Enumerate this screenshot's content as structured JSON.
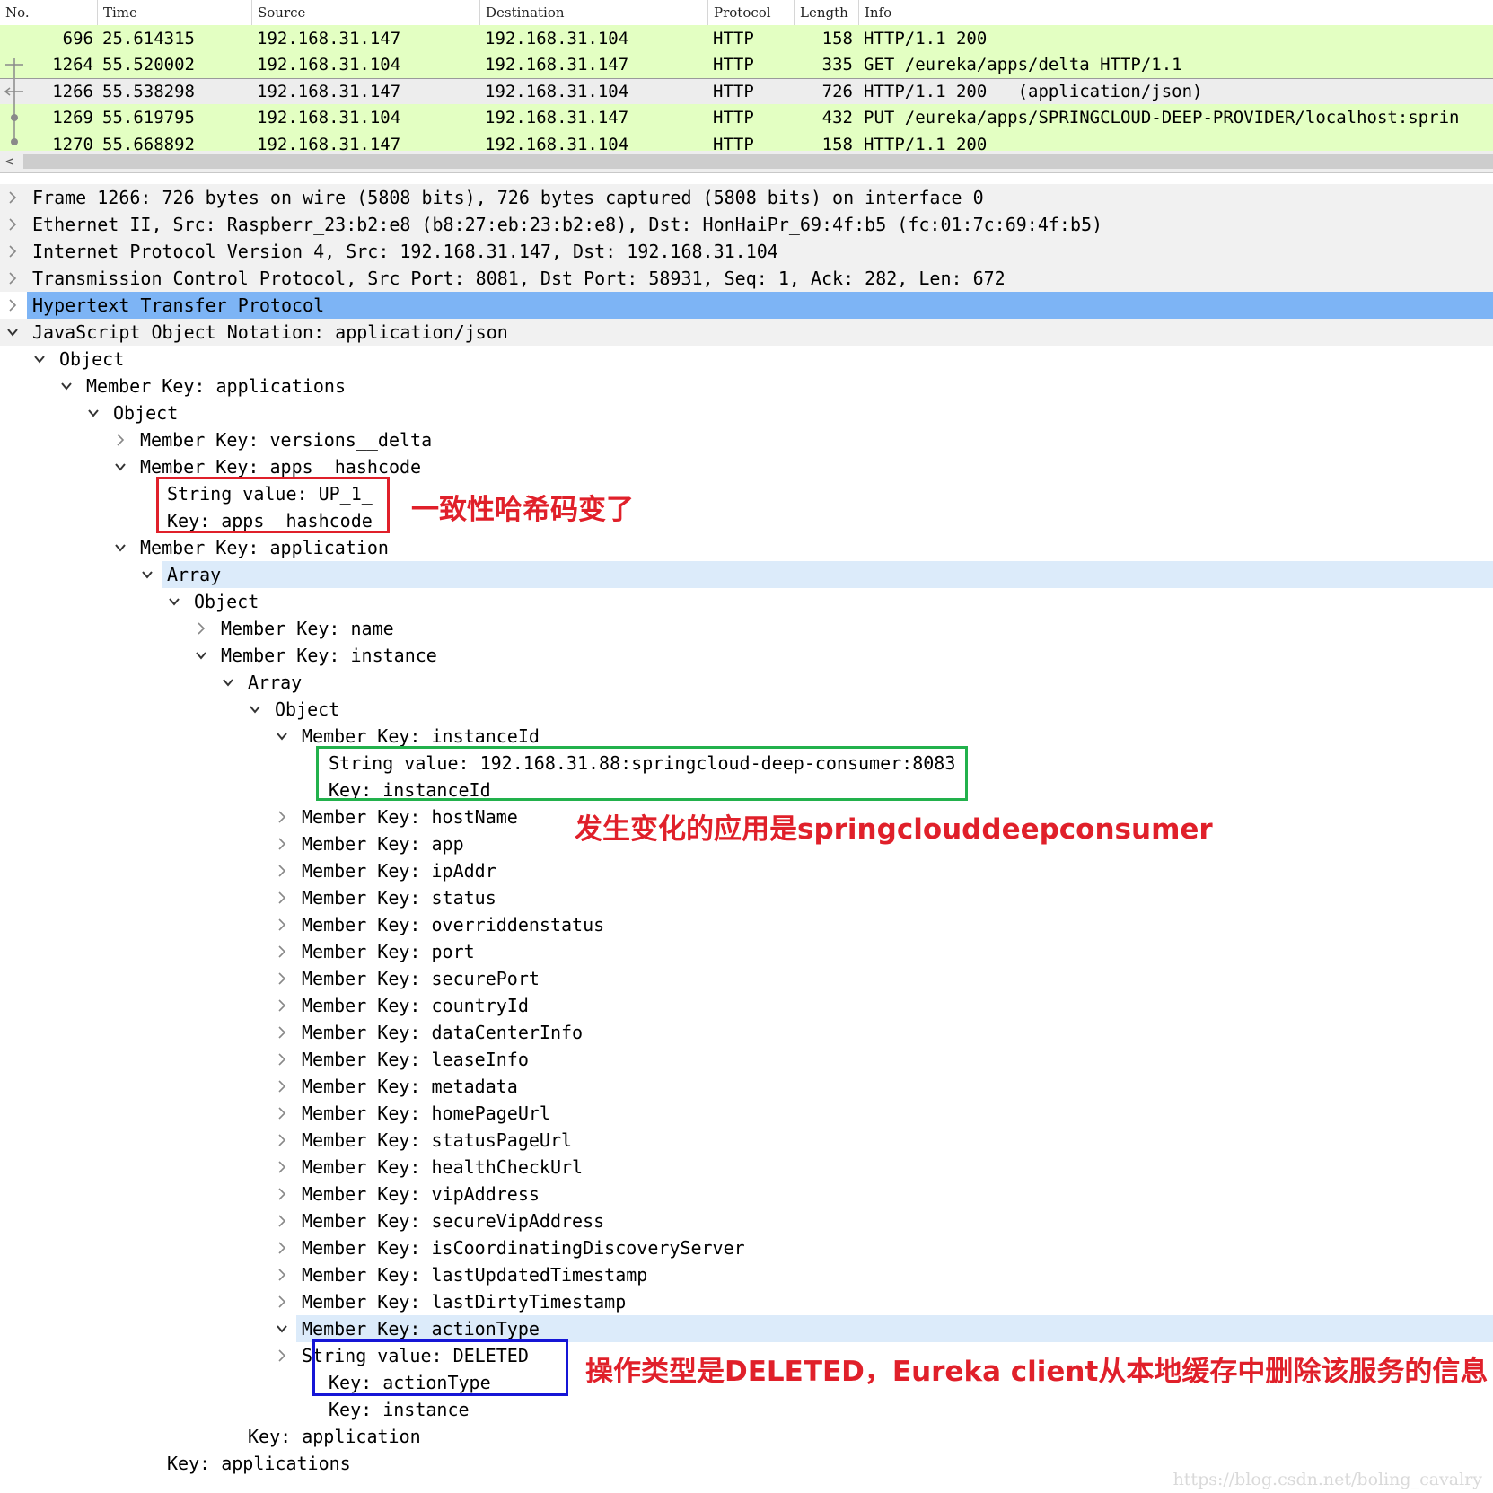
{
  "packet_list": {
    "columns": [
      "No.",
      "Time",
      "Source",
      "Destination",
      "Protocol",
      "Length",
      "Info"
    ],
    "rows": [
      {
        "no": "696",
        "time": "25.614315",
        "source": "192.168.31.147",
        "destination": "192.168.31.104",
        "protocol": "HTTP",
        "length": "158",
        "info": "HTTP/1.1 200"
      },
      {
        "no": "1264",
        "time": "55.520002",
        "source": "192.168.31.104",
        "destination": "192.168.31.147",
        "protocol": "HTTP",
        "length": "335",
        "info": "GET /eureka/apps/delta HTTP/1.1"
      },
      {
        "no": "1266",
        "time": "55.538298",
        "source": "192.168.31.147",
        "destination": "192.168.31.104",
        "protocol": "HTTP",
        "length": "726",
        "info": "HTTP/1.1 200   (application/json)"
      },
      {
        "no": "1269",
        "time": "55.619795",
        "source": "192.168.31.104",
        "destination": "192.168.31.147",
        "protocol": "HTTP",
        "length": "432",
        "info": "PUT /eureka/apps/SPRINGCLOUD-DEEP-PROVIDER/localhost:sprin"
      },
      {
        "no": "1270",
        "time": "55.668892",
        "source": "192.168.31.147",
        "destination": "192.168.31.104",
        "protocol": "HTTP",
        "length": "158",
        "info": "HTTP/1.1 200"
      }
    ],
    "scroll_left_arrow": "<"
  },
  "details": [
    {
      "text": "Frame 1266: 726 bytes on wire (5808 bits), 726 bytes captured (5808 bits) on interface 0"
    },
    {
      "text": "Ethernet II, Src: Raspberr_23:b2:e8 (b8:27:eb:23:b2:e8), Dst: HonHaiPr_69:4f:b5 (fc:01:7c:69:4f:b5)"
    },
    {
      "text": "Internet Protocol Version 4, Src: 192.168.31.147, Dst: 192.168.31.104"
    },
    {
      "text": "Transmission Control Protocol, Src Port: 8081, Dst Port: 58931, Seq: 1, Ack: 282, Len: 672"
    },
    {
      "text": "Hypertext Transfer Protocol"
    },
    {
      "text": "JavaScript Object Notation: application/json"
    },
    {
      "text": "Object"
    },
    {
      "text": "Member Key: applications"
    },
    {
      "text": "Object"
    },
    {
      "text": "Member Key: versions__delta"
    },
    {
      "text": "Member Key: apps__hashcode"
    },
    {
      "text": "String value: UP_1_"
    },
    {
      "text": "Key: apps__hashcode"
    },
    {
      "text": "Member Key: application"
    },
    {
      "text": "Array"
    },
    {
      "text": "Object"
    },
    {
      "text": "Member Key: name"
    },
    {
      "text": "Member Key: instance"
    },
    {
      "text": "Array"
    },
    {
      "text": "Object"
    },
    {
      "text": "Member Key: instanceId"
    },
    {
      "text": "String value: 192.168.31.88:springcloud-deep-consumer:8083"
    },
    {
      "text": "Key: instanceId"
    },
    {
      "text": "Member Key: hostName"
    },
    {
      "text": "Member Key: app"
    },
    {
      "text": "Member Key: ipAddr"
    },
    {
      "text": "Member Key: status"
    },
    {
      "text": "Member Key: overriddenstatus"
    },
    {
      "text": "Member Key: port"
    },
    {
      "text": "Member Key: securePort"
    },
    {
      "text": "Member Key: countryId"
    },
    {
      "text": "Member Key: dataCenterInfo"
    },
    {
      "text": "Member Key: leaseInfo"
    },
    {
      "text": "Member Key: metadata"
    },
    {
      "text": "Member Key: homePageUrl"
    },
    {
      "text": "Member Key: statusPageUrl"
    },
    {
      "text": "Member Key: healthCheckUrl"
    },
    {
      "text": "Member Key: vipAddress"
    },
    {
      "text": "Member Key: secureVipAddress"
    },
    {
      "text": "Member Key: isCoordinatingDiscoveryServer"
    },
    {
      "text": "Member Key: lastUpdatedTimestamp"
    },
    {
      "text": "Member Key: lastDirtyTimestamp"
    },
    {
      "text": "Member Key: actionType"
    },
    {
      "text": "String value: DELETED"
    },
    {
      "text": "Key: actionType"
    },
    {
      "text": "Key: instance"
    },
    {
      "text": "Key: application"
    },
    {
      "text": "Key: applications"
    }
  ],
  "annotations": {
    "hashcode_note": "一致性哈希码变了",
    "app_note": "发生变化的应用是springclouddeepconsumer",
    "action_note": "操作类型是DELETED，Eureka client从本地缓存中删除该服务的信息",
    "colors": {
      "red": "#e0202a",
      "green": "#22b14c",
      "blue": "#1515d6"
    }
  },
  "watermark": "https://blog.csdn.net/boling_cavalry"
}
